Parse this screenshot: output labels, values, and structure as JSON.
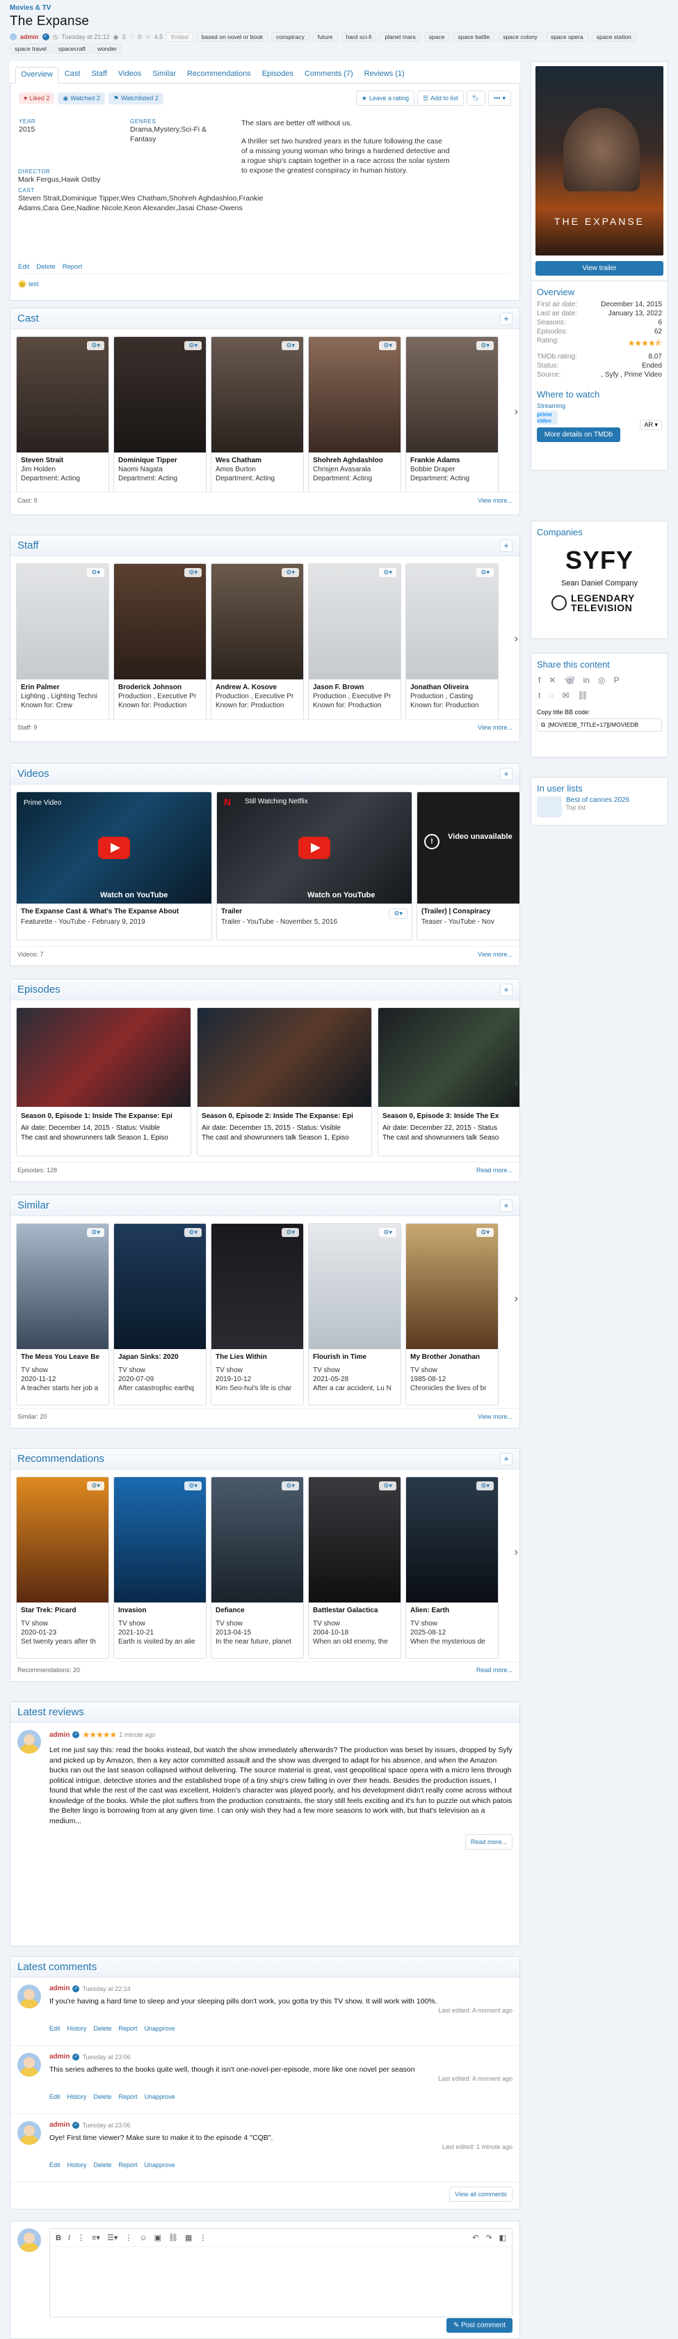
{
  "breadcrumb": "Movies & TV",
  "title": "The Expanse",
  "meta": {
    "author": "admin",
    "date": "Tuesday at 21:12",
    "views": "3",
    "likes": "0",
    "rating": "4.5",
    "badge": "Ended"
  },
  "tags": [
    "based on novel or book",
    "conspiracy",
    "future",
    "hard sci-fi",
    "planet mars",
    "space",
    "space battle",
    "space colony",
    "space opera",
    "space station",
    "space travel",
    "spacecraft",
    "wonder"
  ],
  "tabs": [
    "Overview",
    "Cast",
    "Staff",
    "Videos",
    "Similar",
    "Recommendations",
    "Episodes",
    "Comments (7)",
    "Reviews (1)"
  ],
  "actions": {
    "liked": "Liked 2",
    "watched": "Watched 2",
    "watchlisted": "Watchlisted 2",
    "leave_rating": "Leave a rating",
    "add_list": "Add to list",
    "more": "•••"
  },
  "info": {
    "year_label": "YEAR",
    "year": "2015",
    "genres_label": "GENRES",
    "genres": "Drama,Mystery,Sci-Fi & Fantasy",
    "director_label": "DIRECTOR",
    "director": "Mark Fergus,Hawk Ostby",
    "cast_label": "CAST",
    "cast": "Steven Strait,Dominique Tipper,Wes Chatham,Shohreh Aghdashloo,Frankie Adams,Cara Gee,Nadine Nicole,Keon Alexander,Jasai Chase-Owens",
    "tagline": "The stars are better off without us.",
    "plot": "A thriller set two hundred years in the future following the case of a missing young woman who brings a hardened detective and a rogue ship's captain together in a race across the solar system to expose the greatest conspiracy in human history.",
    "edit": "Edit",
    "delete": "Delete",
    "report": "Report",
    "reaction": "test"
  },
  "cast": {
    "title": "Cast",
    "count": "Cast: 9",
    "more": "View more...",
    "items": [
      {
        "name": "Steven Strait",
        "role": "Jim Holden",
        "dept": "Department: Acting"
      },
      {
        "name": "Dominique Tipper",
        "role": "Naomi Nagata",
        "dept": "Department: Acting"
      },
      {
        "name": "Wes Chatham",
        "role": "Amos Burton",
        "dept": "Department: Acting"
      },
      {
        "name": "Shohreh Aghdashloo",
        "role": "Chrisjen Avasarala",
        "dept": "Department: Acting"
      },
      {
        "name": "Frankie Adams",
        "role": "Bobbie Draper",
        "dept": "Department: Acting"
      }
    ]
  },
  "staff": {
    "title": "Staff",
    "count": "Staff: 9",
    "more": "View more...",
    "items": [
      {
        "name": "Erin Palmer",
        "role": "Lighting , Lighting Techni",
        "dept": "Known for: Crew"
      },
      {
        "name": "Broderick Johnson",
        "role": "Production , Executive Pr",
        "dept": "Known for: Production"
      },
      {
        "name": "Andrew A. Kosove",
        "role": "Production , Executive Pr",
        "dept": "Known for: Production"
      },
      {
        "name": "Jason F. Brown",
        "role": "Production , Executive Pr",
        "dept": "Known for: Production"
      },
      {
        "name": "Jonathan Oliveira",
        "role": "Production , Casting",
        "dept": "Known for: Production"
      }
    ]
  },
  "videos": {
    "title": "Videos",
    "count": "Videos: 7",
    "more": "View more...",
    "items": [
      {
        "title": "The Expanse Cast & What's The Expanse About",
        "sub": "Featurette - YouTube - February 9, 2019",
        "overlay": "Prime Video"
      },
      {
        "title": "Trailer",
        "sub": "Trailer - YouTube - November 5, 2016",
        "overlay": "Still Watching Netflix"
      },
      {
        "title": "(Trailer) | Conspiracy",
        "sub": "Teaser - YouTube - Nov",
        "overlay": "Video unavailable"
      }
    ],
    "watch_on": "Watch on YouTube"
  },
  "episodes": {
    "title": "Episodes",
    "count": "Episodes: 128",
    "more": "Read more...",
    "items": [
      {
        "title": "Season 0, Episode 1: Inside The Expanse: Epi",
        "air": "Air date: December 14, 2015 - Status: Visible",
        "desc": "The cast and showrunners talk Season 1, Episo"
      },
      {
        "title": "Season 0, Episode 2: Inside The Expanse: Epi",
        "air": "Air date: December 15, 2015 - Status: Visible",
        "desc": "The cast and showrunners talk Season 1, Episo"
      },
      {
        "title": "Season 0, Episode 3: Inside The Ex",
        "air": "Air date: December 22, 2015 - Status",
        "desc": "The cast and showrunners talk Seaso"
      }
    ]
  },
  "similar": {
    "title": "Similar",
    "count": "Similar: 20",
    "more": "View more...",
    "items": [
      {
        "name": "The Mess You Leave Be",
        "type": "TV show",
        "date": "2020-11-12",
        "desc": "A teacher starts her job a"
      },
      {
        "name": "Japan Sinks: 2020",
        "type": "TV show",
        "date": "2020-07-09",
        "desc": "After catastrophic earthq"
      },
      {
        "name": "The Lies Within",
        "type": "TV show",
        "date": "2019-10-12",
        "desc": "Kim Seo-hui's life is char"
      },
      {
        "name": "Flourish in Time",
        "type": "TV show",
        "date": "2021-05-28",
        "desc": "After a car accident, Lu N"
      },
      {
        "name": "My Brother Jonathan",
        "type": "TV show",
        "date": "1985-08-12",
        "desc": "Chronicles the lives of br"
      }
    ]
  },
  "recommendations": {
    "title": "Recommendations",
    "count": "Recommendations: 20",
    "more": "Read more...",
    "items": [
      {
        "name": "Star Trek: Picard",
        "type": "TV show",
        "date": "2020-01-23",
        "desc": "Set twenty years after th"
      },
      {
        "name": "Invasion",
        "type": "TV show",
        "date": "2021-10-21",
        "desc": "Earth is visited by an alie"
      },
      {
        "name": "Defiance",
        "type": "TV show",
        "date": "2013-04-15",
        "desc": "In the near future, planet"
      },
      {
        "name": "Battlestar Galactica",
        "type": "TV show",
        "date": "2004-10-18",
        "desc": "When an old enemy, the"
      },
      {
        "name": "Alien: Earth",
        "type": "TV show",
        "date": "2025-08-12",
        "desc": "When the mysterious de"
      }
    ]
  },
  "reviews": {
    "title": "Latest reviews",
    "user": "admin",
    "time": "1 minute ago",
    "more": "Read more...",
    "text": "Let me just say this: read the books instead, but watch the show immediately afterwards? The production was beset by issues, dropped by Syfy and picked up by Amazon, then a key actor committed assault and the show was diverged to adapt for his absence, and when the Amazon bucks ran out the last season collapsed without delivering. The source material is great, vast geopolitical space opera with a micro lens through political intrigue, detective stories and the established trope of a tiny ship's crew falling in over their heads. Besides the production issues, I found that while the rest of the cast was excellent, Holden's character was played poorly, and his development didn't really come across without knowledge of the books. While the plot suffers from the production constraints, the story still feels exciting and it's fun to puzzle out which patois the Belter lingo is borrowing from at any given time. I can only wish they had a few more seasons to work with, but that's television as a medium..."
  },
  "comments": {
    "title": "Latest comments",
    "view_all": "View all comments",
    "actions": [
      "Edit",
      "History",
      "Delete",
      "Report",
      "Unapprove"
    ],
    "items": [
      {
        "user": "admin",
        "time": "Tuesday at 22:24",
        "text": "If you're having a hard time to sleep and your sleeping pills don't work, you gotta try this TV show. It will work with 100%.",
        "edited": "Last edited: A moment ago"
      },
      {
        "user": "admin",
        "time": "Tuesday at 23:06",
        "text": "This series adheres to the books quite well, though it isn't one-novel-per-episode, more like one novel per season",
        "edited": "Last edited: A moment ago"
      },
      {
        "user": "admin",
        "time": "Tuesday at 23:06",
        "text": "Oye! First time viewer? Make sure to make it to the episode 4 \"CQB\".",
        "edited": "Last edited: 1 minute ago"
      }
    ]
  },
  "editor": {
    "post_label": "Post comment"
  },
  "sidebar": {
    "poster_title": "THE EXPANSE",
    "trailer": "View trailer",
    "overview_title": "Overview",
    "rows": [
      {
        "k": "First air date:",
        "v": "December 14, 2015"
      },
      {
        "k": "Last air date:",
        "v": "January 13, 2022"
      },
      {
        "k": "Seasons:",
        "v": "6"
      },
      {
        "k": "Episodes:",
        "v": "62"
      },
      {
        "k": "Rating:",
        "v": ""
      },
      {
        "k": "TMDb rating:",
        "v": "8.07"
      },
      {
        "k": "Status:",
        "v": "Ended"
      },
      {
        "k": "Source:",
        "v": ", Syfy , Prime Video"
      }
    ],
    "rating_stars": 4.5,
    "where_title": "Where to watch",
    "region": "AR",
    "streaming": "Streaming",
    "provider": "prime video",
    "tmdb_btn": "More details on TMDb",
    "companies_title": "Companies",
    "companies": [
      "SYFY",
      "Sean Daniel Company",
      "LEGENDARY TELEVISION"
    ],
    "share_title": "Share this content",
    "bb_label": "Copy title BB code:",
    "bb_code": "[MOVIEDB_TITLE=17][/MOVIEDB",
    "lists_title": "In user lists",
    "list_name": "Best of cannes 2026",
    "list_sub": "Top list"
  },
  "colors": {
    "accent": "#2577b1",
    "brand_red": "#c23b3b",
    "star": "#f7a21b"
  }
}
